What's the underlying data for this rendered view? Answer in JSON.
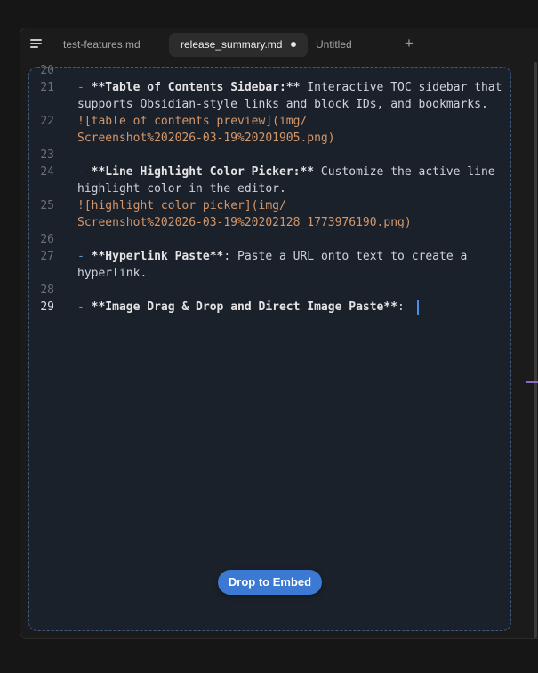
{
  "tabs": [
    {
      "label": "test-features.md",
      "active": false
    },
    {
      "label": "release_summary.md",
      "active": true,
      "modified": true
    },
    {
      "label": "Untitled",
      "active": false
    }
  ],
  "add_tab_label": "+",
  "editor": {
    "lines": [
      {
        "n": "20"
      },
      {
        "n": "21",
        "a": "- ",
        "b": "**Table of Contents Sidebar:**",
        "c": " Interactive TOC sidebar that"
      },
      {
        "n": "",
        "c": "supports Obsidian-style links and block IDs, and bookmarks."
      },
      {
        "n": "22",
        "a": "![",
        "c": "table of contents preview",
        "d": "](img/"
      },
      {
        "n": "",
        "d": "Screenshot%202026-03-19%20201905.png)"
      },
      {
        "n": "23"
      },
      {
        "n": "24",
        "a": "- ",
        "b": "**Line Highlight Color Picker:**",
        "c": " Customize the active line"
      },
      {
        "n": "",
        "c": "highlight color in the editor."
      },
      {
        "n": "25",
        "a": "![",
        "c": "highlight color picker",
        "d": "](img/"
      },
      {
        "n": "",
        "d": "Screenshot%202026-03-19%20202128_1773976190.png)"
      },
      {
        "n": "26"
      },
      {
        "n": "27",
        "a": "- ",
        "b": "**Hyperlink Paste**",
        "c": ": Paste a URL onto text to create a"
      },
      {
        "n": "",
        "c": "hyperlink."
      },
      {
        "n": "28"
      },
      {
        "n": "29",
        "a": "- ",
        "b": "**Image Drag & Drop and Direct Image Paste**",
        "c": ": ",
        "current": true
      }
    ]
  },
  "drop_button_label": "Drop to Embed",
  "colors": {
    "accent": "#3b79d2",
    "link": "#d4976a",
    "bullet": "#5c9ad0",
    "cursor": "#4a90e2",
    "scroll_marker": "#8a6cc4"
  },
  "icons": {
    "menu": "hamburger-menu-icon",
    "modified": "unsaved-dot-icon"
  }
}
